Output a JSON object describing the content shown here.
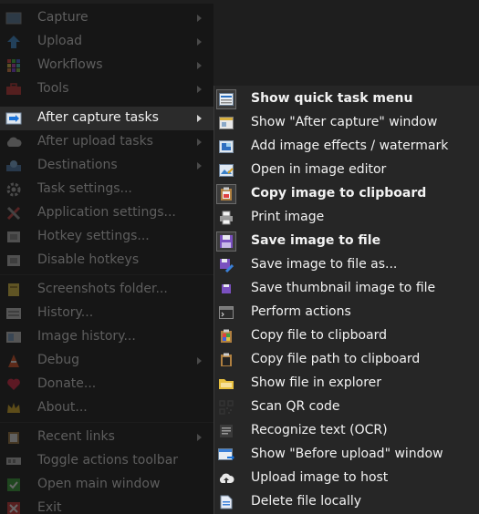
{
  "main_menu": {
    "items": [
      {
        "label": "Capture",
        "icon": "capture-icon",
        "submenu": true
      },
      {
        "label": "Upload",
        "icon": "upload-arrow-icon",
        "submenu": true
      },
      {
        "label": "Workflows",
        "icon": "workflows-grid-icon",
        "submenu": true
      },
      {
        "label": "Tools",
        "icon": "toolbox-icon",
        "submenu": true
      },
      {
        "label": "After capture tasks",
        "icon": "after-capture-icon",
        "submenu": true,
        "active": true
      },
      {
        "label": "After upload tasks",
        "icon": "cloud-icon",
        "submenu": true
      },
      {
        "label": "Destinations",
        "icon": "destinations-icon",
        "submenu": true
      },
      {
        "label": "Task settings...",
        "icon": "gear-icon",
        "submenu": false
      },
      {
        "label": "Application settings...",
        "icon": "wrench-screwdriver-icon",
        "submenu": false
      },
      {
        "label": "Hotkey settings...",
        "icon": "keyboard-icon",
        "submenu": false
      },
      {
        "label": "Disable hotkeys",
        "icon": "keyboard-disabled-icon",
        "submenu": false
      },
      {
        "label": "Screenshots folder...",
        "icon": "folder-icon",
        "submenu": false
      },
      {
        "label": "History...",
        "icon": "history-icon",
        "submenu": false
      },
      {
        "label": "Image history...",
        "icon": "image-history-icon",
        "submenu": false
      },
      {
        "label": "Debug",
        "icon": "debug-cone-icon",
        "submenu": true
      },
      {
        "label": "Donate...",
        "icon": "heart-icon",
        "submenu": false
      },
      {
        "label": "About...",
        "icon": "crown-icon",
        "submenu": false
      },
      {
        "label": "Recent links",
        "icon": "clipboard-icon",
        "submenu": true
      },
      {
        "label": "Toggle actions toolbar",
        "icon": "toolbar-icon",
        "submenu": false
      },
      {
        "label": "Open main window",
        "icon": "checkmark-icon",
        "submenu": false
      },
      {
        "label": "Exit",
        "icon": "exit-icon",
        "submenu": false
      }
    ]
  },
  "submenu": {
    "items": [
      {
        "label": "Show quick task menu",
        "icon": "quick-task-menu-icon",
        "checked": true,
        "bold": true
      },
      {
        "label": "Show \"After capture\" window",
        "icon": "window-icon",
        "checked": false,
        "bold": false
      },
      {
        "label": "Add image effects / watermark",
        "icon": "image-effects-icon",
        "checked": false,
        "bold": false
      },
      {
        "label": "Open in image editor",
        "icon": "image-editor-icon",
        "checked": false,
        "bold": false
      },
      {
        "label": "Copy image to clipboard",
        "icon": "clipboard-image-icon",
        "checked": true,
        "bold": true
      },
      {
        "label": "Print image",
        "icon": "printer-icon",
        "checked": false,
        "bold": false
      },
      {
        "label": "Save image to file",
        "icon": "floppy-disk-icon",
        "checked": true,
        "bold": true
      },
      {
        "label": "Save image to file as...",
        "icon": "floppy-disk-pen-icon",
        "checked": false,
        "bold": false
      },
      {
        "label": "Save thumbnail image to file",
        "icon": "thumbnail-save-icon",
        "checked": false,
        "bold": false
      },
      {
        "label": "Perform actions",
        "icon": "terminal-icon",
        "checked": false,
        "bold": false
      },
      {
        "label": "Copy file to clipboard",
        "icon": "copy-file-icon",
        "checked": false,
        "bold": false
      },
      {
        "label": "Copy file path to clipboard",
        "icon": "copy-path-icon",
        "checked": false,
        "bold": false
      },
      {
        "label": "Show file in explorer",
        "icon": "explorer-folder-icon",
        "checked": false,
        "bold": false
      },
      {
        "label": "Scan QR code",
        "icon": "qr-code-icon",
        "checked": false,
        "bold": false
      },
      {
        "label": "Recognize text (OCR)",
        "icon": "ocr-text-icon",
        "checked": false,
        "bold": false
      },
      {
        "label": "Show \"Before upload\" window",
        "icon": "before-upload-window-icon",
        "checked": false,
        "bold": false
      },
      {
        "label": "Upload image to host",
        "icon": "cloud-upload-icon",
        "checked": false,
        "bold": false
      },
      {
        "label": "Delete file locally",
        "icon": "delete-file-icon",
        "checked": false,
        "bold": false
      }
    ]
  }
}
